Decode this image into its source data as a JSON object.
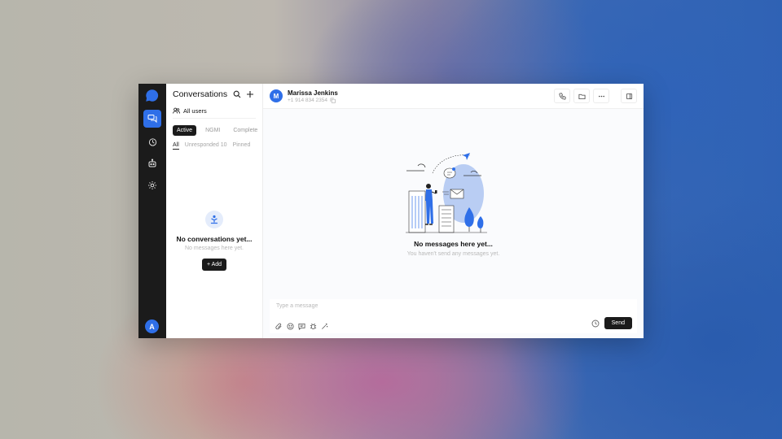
{
  "colors": {
    "accent": "#2f6fe8",
    "rail_bg": "#1b1b1b",
    "dark_button": "#1b1b1b"
  },
  "rail": {
    "logo_icon": "chat-bubble-logo-icon",
    "items": [
      {
        "name": "conversations",
        "icon": "conversations-icon",
        "active": true
      },
      {
        "name": "analytics",
        "icon": "clock-chart-icon",
        "active": false
      },
      {
        "name": "bot",
        "icon": "robot-icon",
        "active": false
      },
      {
        "name": "settings",
        "icon": "gear-icon",
        "active": false
      }
    ],
    "user_initial": "A"
  },
  "list": {
    "title": "Conversations",
    "users_filter": "All users",
    "status_tabs": [
      "Active",
      "NGMI",
      "Complete"
    ],
    "sub_tabs": [
      "All",
      "Unresponded 10",
      "Pinned"
    ],
    "empty_title": "No conversations yet...",
    "empty_subtitle": "No messages here yet.",
    "add_label": "+ Add"
  },
  "chat": {
    "contact_initial": "M",
    "contact_name": "Marissa Jenkins",
    "contact_phone": "+1 914 834 2354",
    "empty_title": "No messages here yet...",
    "empty_subtitle": "You haven't send any messages yet.",
    "composer_placeholder": "Type a message",
    "send_label": "Send"
  }
}
